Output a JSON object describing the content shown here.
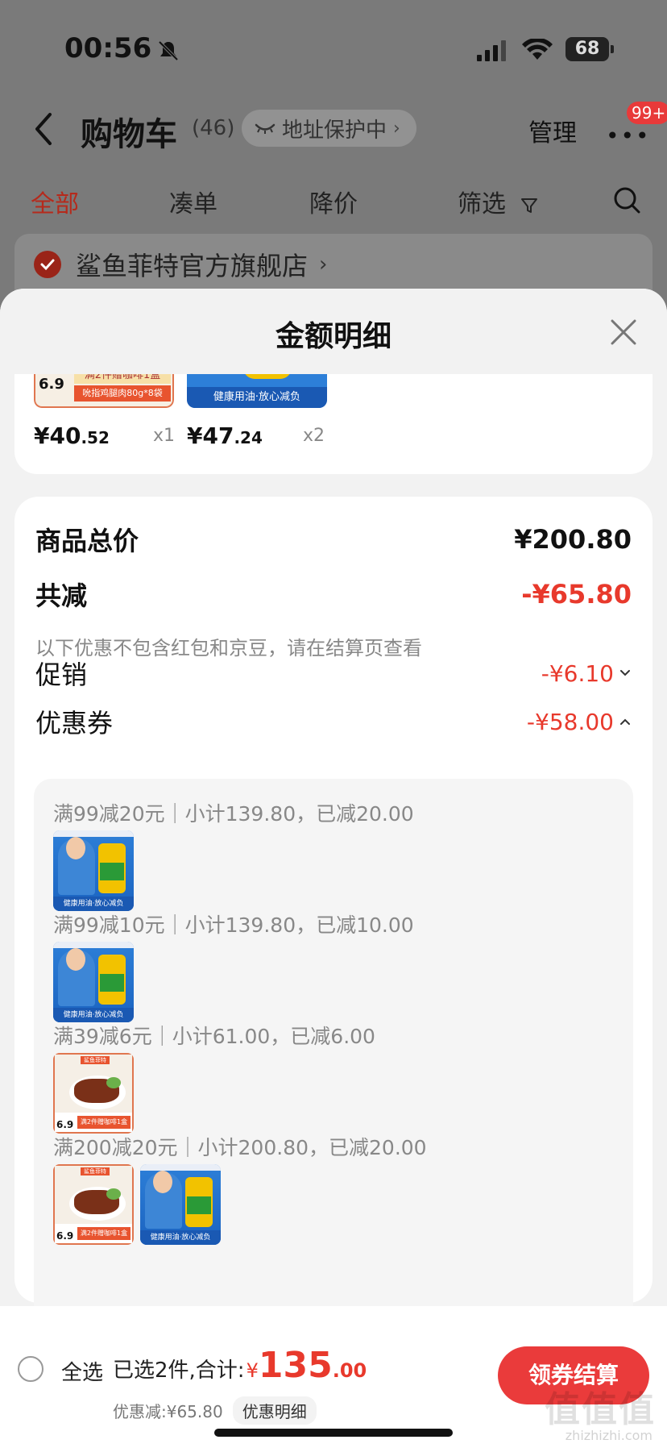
{
  "status_bar": {
    "time": "00:56",
    "battery": "68"
  },
  "nav": {
    "title": "购物车",
    "count": "(46)",
    "address_protect": "地址保护中",
    "manage": "管理",
    "badge": "99+"
  },
  "tabs": [
    {
      "label": "全部",
      "active": true
    },
    {
      "label": "凑单",
      "active": false
    },
    {
      "label": "降价",
      "active": false
    },
    {
      "label": "筛选",
      "active": false
    }
  ],
  "store": {
    "name": "鲨鱼菲特官方旗舰店"
  },
  "sheet": {
    "title": "金额明细",
    "items": [
      {
        "price_int": "¥40",
        "price_dec": ".52",
        "qty": "x1",
        "thumb": "chicken",
        "promo": "满2件赠咖啡1盒",
        "sub": "吮指鸡腿肉80g*8袋",
        "price_tag": "6.9"
      },
      {
        "price_int": "¥47",
        "price_dec": ".24",
        "qty": "x2",
        "thumb": "oil",
        "promo": "健康用油·放心减负"
      }
    ],
    "total_label": "商品总价",
    "total_value": "¥200.80",
    "reduce_label": "共减",
    "reduce_value": "-¥65.80",
    "note": "以下优惠不包含红包和京豆，请在结算页查看",
    "promo_label": "促销",
    "promo_value": "-¥6.10",
    "coupon_label": "优惠券",
    "coupon_value": "-¥58.00",
    "coupons": [
      {
        "text": "满99减20元｜小计139.80，已减20.00",
        "thumbs": [
          "oil"
        ]
      },
      {
        "text": "满99减10元｜小计139.80，已减10.00",
        "thumbs": [
          "oil"
        ]
      },
      {
        "text": "满39减6元｜小计61.00，已减6.00",
        "thumbs": [
          "chicken"
        ]
      },
      {
        "text": "满200减20元｜小计200.80，已减20.00",
        "thumbs": [
          "chicken",
          "oil"
        ]
      }
    ],
    "thumb_labels": {
      "oil_strip": "健康用油·放心减负",
      "chicken_price": "6.9",
      "chicken_promo": "满2件赠咖啡1盒",
      "chicken_brand": "鲨鱼菲特"
    }
  },
  "checkout": {
    "select_all": "全选",
    "selected_text": "已选2件,合计:",
    "currency": "¥",
    "total_int": "135",
    "total_dec": ".00",
    "discount_text": "优惠减:¥65.80",
    "detail_link": "优惠明细",
    "button": "领券结算"
  },
  "watermark": {
    "main": "值值值",
    "sub": "zhizhizhi.com"
  },
  "colors": {
    "accent_red": "#e8392c",
    "button_red": "#ea3b3b"
  }
}
